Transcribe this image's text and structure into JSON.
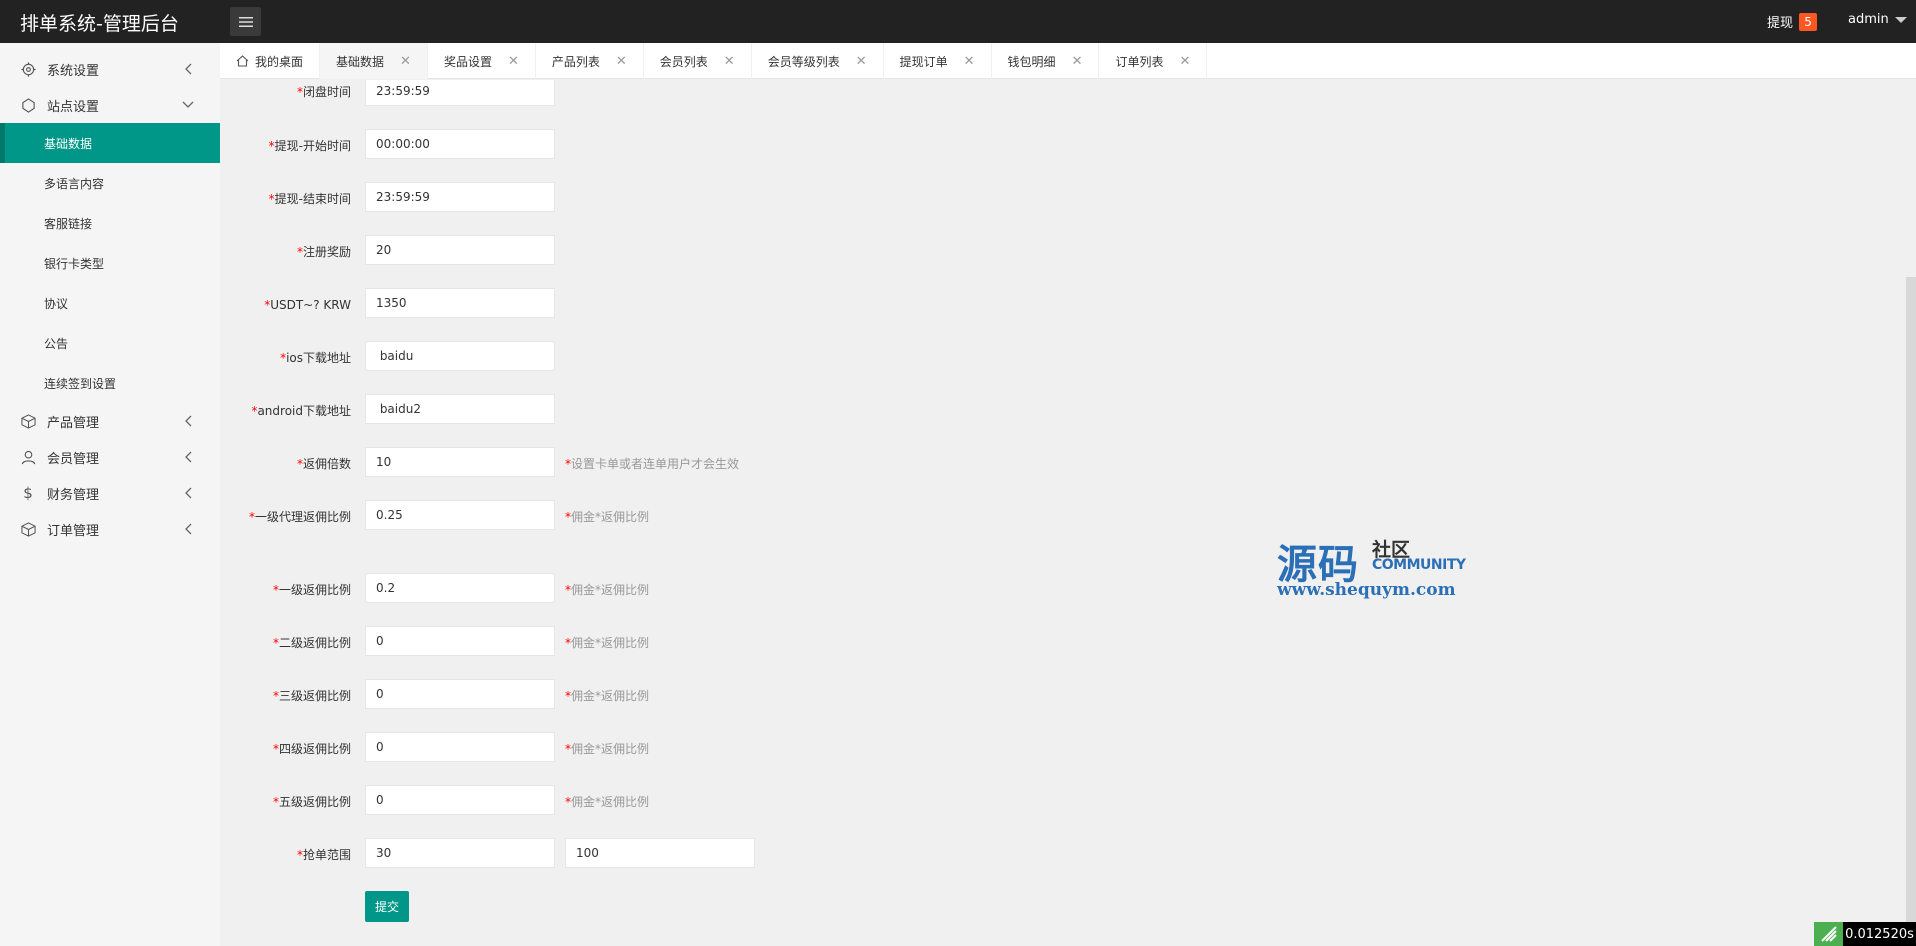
{
  "header": {
    "title": "排单系统-管理后台",
    "withdraw_label": "提现",
    "withdraw_count": "5",
    "user": "admin"
  },
  "sidebar": {
    "groups": [
      {
        "label": "系统设置",
        "icon": "gear-icon"
      },
      {
        "label": "站点设置",
        "icon": "site-icon",
        "expanded": true
      },
      {
        "label": "产品管理",
        "icon": "box-icon"
      },
      {
        "label": "会员管理",
        "icon": "user-icon"
      },
      {
        "label": "财务管理",
        "icon": "dollar-icon"
      },
      {
        "label": "订单管理",
        "icon": "order-icon"
      }
    ],
    "items": [
      {
        "label": "基础数据",
        "active": true
      },
      {
        "label": "多语言内容"
      },
      {
        "label": "客服链接"
      },
      {
        "label": "银行卡类型"
      },
      {
        "label": "协议"
      },
      {
        "label": "公告"
      },
      {
        "label": "连续签到设置"
      }
    ]
  },
  "tabs": [
    {
      "label": "我的桌面",
      "icon": "home-icon"
    },
    {
      "label": "基础数据",
      "active": true
    },
    {
      "label": "奖品设置"
    },
    {
      "label": "产品列表"
    },
    {
      "label": "会员列表"
    },
    {
      "label": "会员等级列表"
    },
    {
      "label": "提现订单"
    },
    {
      "label": "钱包明细"
    },
    {
      "label": "订单列表"
    }
  ],
  "form": {
    "fields": [
      {
        "label": "闭盘时间",
        "value": "23:59:59"
      },
      {
        "label": "提现-开始时间",
        "value": "00:00:00"
      },
      {
        "label": "提现-结束时间",
        "value": "23:59:59"
      },
      {
        "label": "注册奖励",
        "value": "20"
      },
      {
        "label": "USDT~?  KRW",
        "value": "1350"
      },
      {
        "label": "ios下载地址",
        "value": " baidu"
      },
      {
        "label": "android下载地址",
        "value": " baidu2"
      },
      {
        "label": "返佣倍数",
        "value": "10",
        "hint": "设置卡单或者连单用户才会生效"
      },
      {
        "label": "一级代理返佣比例",
        "value": "0.25",
        "hint": "佣金*返佣比例"
      },
      {
        "label": "一级返佣比例",
        "value": "0.2",
        "hint": "佣金*返佣比例"
      },
      {
        "label": "二级返佣比例",
        "value": "0",
        "hint": "佣金*返佣比例"
      },
      {
        "label": "三级返佣比例",
        "value": "0",
        "hint": "佣金*返佣比例"
      },
      {
        "label": "四级返佣比例",
        "value": "0",
        "hint": "佣金*返佣比例"
      },
      {
        "label": "五级返佣比例",
        "value": "0",
        "hint": "佣金*返佣比例"
      },
      {
        "label": "抢单范围",
        "value": "30",
        "value2": "100"
      }
    ],
    "submit_label": "提交"
  },
  "watermark": {
    "cn": "源码",
    "cn2": "社区",
    "en": "COMMUNITY",
    "url": "www.shequym.com"
  },
  "timer": "0.012520s",
  "colors": {
    "accent": "#009688",
    "header_bg": "#222222",
    "badge": "#ff5722"
  }
}
